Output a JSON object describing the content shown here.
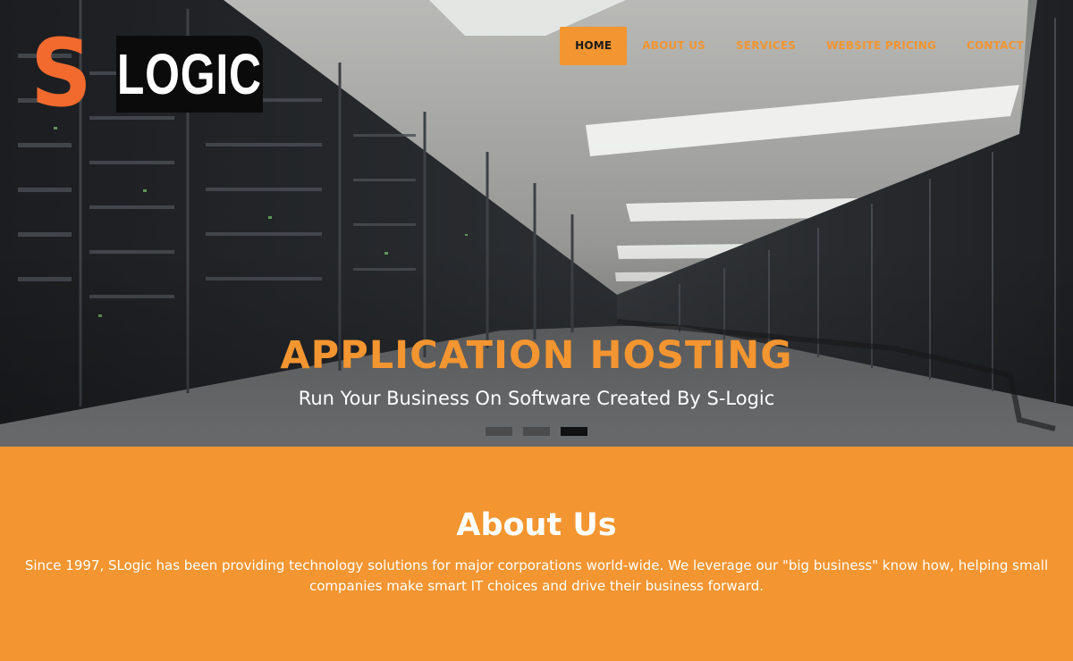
{
  "brand": {
    "logo_letter": "S",
    "logo_word": "LOGIC",
    "accent_color": "#f39530",
    "logo_s_color": "#f26a2e"
  },
  "nav": {
    "items": [
      {
        "label": "HOME",
        "active": true
      },
      {
        "label": "ABOUT US",
        "active": false
      },
      {
        "label": "SERVICES",
        "active": false
      },
      {
        "label": "WEBSITE PRICING",
        "active": false
      },
      {
        "label": "CONTACT",
        "active": false
      }
    ]
  },
  "hero": {
    "title": "APPLICATION HOSTING",
    "subtitle": "Run Your Business On Software Created By S-Logic",
    "background": "server-room-photo",
    "slides_count": 3,
    "active_slide": 3
  },
  "about": {
    "heading": "About Us",
    "body": "Since 1997, SLogic has been providing technology solutions for major corporations world-wide. We leverage our \"big business\" know how, helping small companies make smart IT choices and drive their business forward."
  }
}
